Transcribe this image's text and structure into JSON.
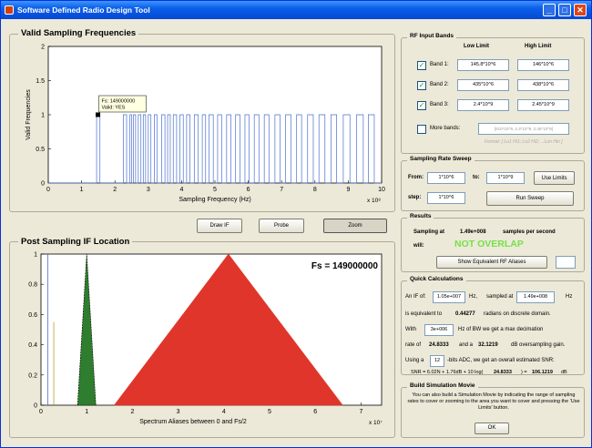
{
  "window": {
    "title": "Software Defined Radio Design Tool",
    "minimize": "_",
    "maximize": "□",
    "close": "✕"
  },
  "top_panel": {
    "title": "Valid Sampling Frequencies"
  },
  "bottom_panel": {
    "title": "Post Sampling IF Location"
  },
  "buttons": {
    "draw_if": "Draw IF",
    "probe": "Probe",
    "zoom": "Zoom"
  },
  "chart_data": [
    {
      "type": "line",
      "title": "",
      "xlabel": "Sampling Frequency (Hz)",
      "ylabel": "Valid Frequencies",
      "x_multiplier": "x 10⁸",
      "xlim": [
        0,
        10
      ],
      "ylim": [
        0,
        2
      ],
      "x_ticks": [
        "0",
        "1",
        "2",
        "3",
        "4",
        "5",
        "6",
        "7",
        "8",
        "9",
        "10"
      ],
      "y_ticks": [
        "0",
        "0.5",
        "1",
        "1.5",
        "2"
      ],
      "series": [
        {
          "values": "valid (1) / invalid (0) steps, dense valid bands between ~2.3 and ~9.8 x10^8 Hz"
        }
      ],
      "annotation": {
        "line1": "Fs: 149000000",
        "line2": "Valid: YES",
        "x": 1.49,
        "y": 1
      }
    },
    {
      "type": "area",
      "title": "Fs = 149000000",
      "xlabel": "Spectrum Aliases between 0 and Fs/2",
      "x_multiplier": "x 10⁷",
      "xlim": [
        0,
        7.45
      ],
      "ylim": [
        0,
        1
      ],
      "x_ticks": [
        "0",
        "1",
        "2",
        "3",
        "4",
        "5",
        "6",
        "7"
      ],
      "y_ticks": [
        "0",
        "0.2",
        "0.4",
        "0.6",
        "0.8",
        "1"
      ],
      "series": [
        {
          "color": "#e0352a",
          "shape": "triangle",
          "x": [
            1.6,
            4.1,
            6.6
          ],
          "y": [
            0,
            1,
            0
          ]
        },
        {
          "color": "#2f7d2f",
          "shape": "triangle",
          "x": [
            0.8,
            1.0,
            1.2
          ],
          "y": [
            0,
            1,
            0
          ]
        }
      ]
    }
  ],
  "rf": {
    "title": "RF Input Bands",
    "low_header": "Low Limit",
    "high_header": "High Limit",
    "bands": [
      {
        "label": "Band 1:",
        "checked": true,
        "low": "145.8*10^6",
        "high": "146*10^6"
      },
      {
        "label": "Band 2:",
        "checked": true,
        "low": "435*10^6",
        "high": "438*10^6"
      },
      {
        "label": "Band 3:",
        "checked": true,
        "low": "2.4*10^9",
        "high": "2.45*10^9"
      }
    ],
    "more_label": "More bands:",
    "more_placeholder": "[610*10^6, 2.4*10^9, 2.45*10^9]",
    "format": "Format: [ Lo1 Hi1; Lo2 Hi2; ...Lon Hin ]"
  },
  "sweep": {
    "title": "Sampling Rate Sweep",
    "from_label": "From:",
    "from": "1*10^6",
    "to_label": "to:",
    "to": "1*10^9",
    "step_label": "step:",
    "step": "1*10^6",
    "use_limits": "Use Limits",
    "run": "Run Sweep"
  },
  "results": {
    "title": "Results",
    "sampling_at": "Sampling at",
    "rate": "1.49e+008",
    "sps": "samples per second",
    "will": "will:",
    "verdict": "NOT OVERLAP",
    "aliases_btn": "Show Equivalent RF Aliases"
  },
  "quick": {
    "title": "Quick Calculations",
    "if_at": "An IF of:",
    "if_val": "1.05e+007",
    "hz1": "Hz,",
    "sampled_at": "sampled at",
    "samp_val": "1.49e+008",
    "hz2": "Hz",
    "equiv": "is equivalent to",
    "rad_val": "0.44277",
    "rad_txt": "radians on discrete domain.",
    "with": "With",
    "bw_val": "3e+006",
    "bw_txt": "Hz of BW we get a max decimation",
    "rate_of": "rate of",
    "dec_val": "24.8333",
    "and_a": "and a",
    "gain_val": "32.1219",
    "gain_txt": "dB oversampling gain.",
    "using": "Using a",
    "bits": "12",
    "adc_txt": "-bits ADC, we get an overall estimated SNR:",
    "snr_pre": "SNR = 6.02N + 1.76dB + 10 log(",
    "snr_dec": "24.8333",
    "snr_post": ") =",
    "snr_val": "106.1219",
    "snr_db": "dB"
  },
  "movie": {
    "title": "Build Simulation Movie",
    "text": "You can also build a Simulation Movie by indicating the range of sampling rates to cover or zooming to the area you want to cover and pressing the 'Use Limits' button.",
    "ok": "OK"
  }
}
